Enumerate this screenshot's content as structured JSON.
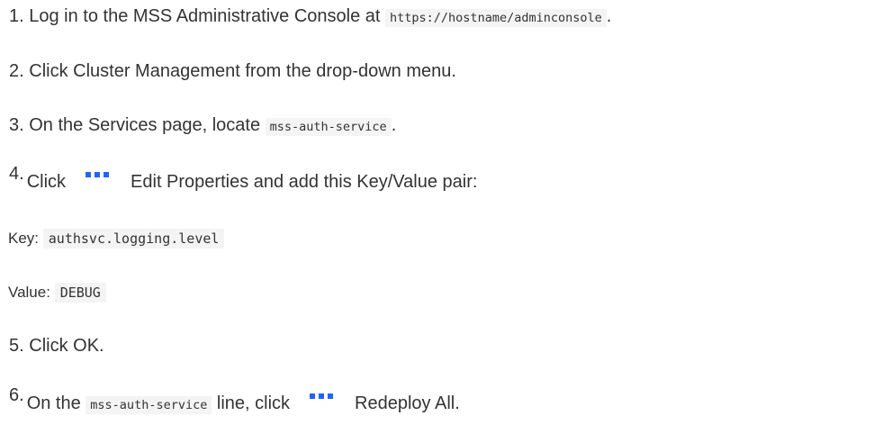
{
  "colors": {
    "text": "#333333",
    "code_bg": "#f4f4f4",
    "dots_icon": "#1e64ff"
  },
  "steps": {
    "s1": {
      "num": "1.",
      "text_a": "Log in to the MSS Administrative Console at",
      "code": "https://hostname/adminconsole",
      "text_b": "."
    },
    "s2": {
      "num": "2.",
      "text": "Click Cluster Management from the drop-down menu."
    },
    "s3": {
      "num": "3.",
      "text_a": "On the Services page, locate",
      "code": "mss-auth-service",
      "text_b": "."
    },
    "s4": {
      "num": "4.",
      "text_a": "Click",
      "icon": "more-actions-dots-icon",
      "text_b": "Edit Properties and add this Key/Value pair:"
    },
    "key": {
      "label": "Key:",
      "value": "authsvc.logging.level"
    },
    "value": {
      "label": "Value:",
      "value": "DEBUG"
    },
    "s5": {
      "num": "5.",
      "text": "Click OK."
    },
    "s6": {
      "num": "6.",
      "text_a": "On the",
      "code": "mss-auth-service",
      "text_b": "line, click",
      "icon": "more-actions-dots-icon",
      "text_c": "Redeploy All."
    }
  }
}
